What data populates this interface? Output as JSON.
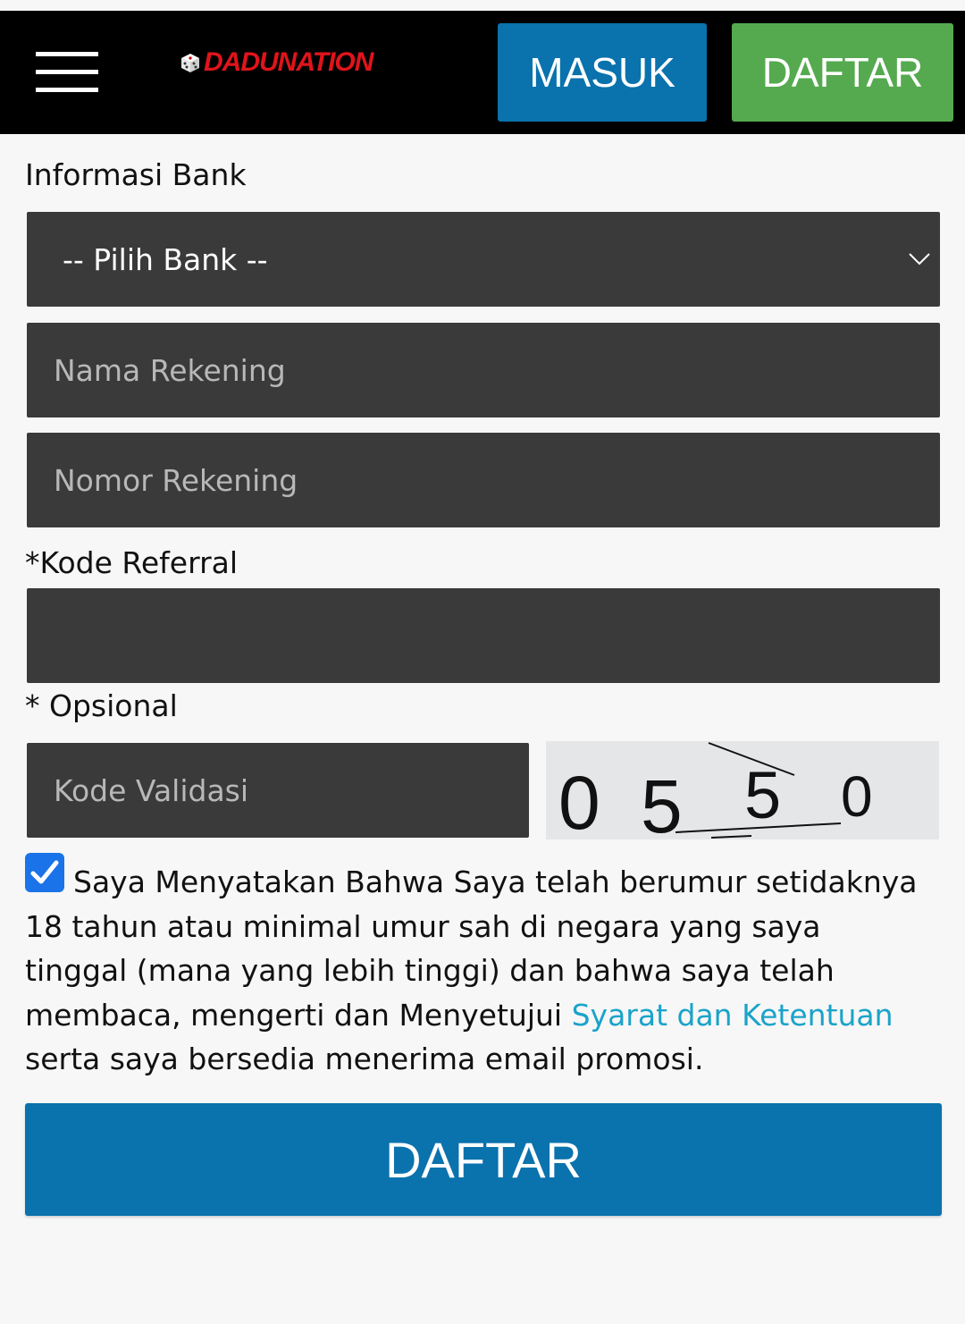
{
  "header": {
    "logo_text": "DADUNATION",
    "login_label": "MASUK",
    "register_label": "DAFTAR"
  },
  "bank_section": {
    "heading": "Informasi Bank",
    "bank_select_value": "-- Pilih Bank --",
    "account_name_placeholder": "Nama Rekening",
    "account_number_placeholder": "Nomor Rekening"
  },
  "referral": {
    "label": "*Kode Referral",
    "value": "",
    "optional_note": "* Opsional"
  },
  "validation": {
    "input_placeholder": "Kode Validasi",
    "captcha_digits": [
      "0",
      "5",
      "5",
      "0"
    ]
  },
  "terms": {
    "checked": true,
    "text_before": "Saya Menyatakan Bahwa Saya telah berumur setidaknya 18 tahun atau minimal umur sah di negara yang saya tinggal (mana yang lebih tinggi) dan bahwa saya telah membaca, mengerti dan Menyetujui ",
    "link_text": "Syarat dan Ketentuan",
    "text_after": " serta saya bersedia menerima email promosi."
  },
  "submit_label": "DAFTAR",
  "colors": {
    "header_bg": "#000000",
    "login_button": "#0a72ad",
    "register_button": "#55aa4f",
    "field_bg": "#3a3a3a",
    "link": "#1aa3c9",
    "checkbox": "#1a73e8",
    "logo": "#e0141b"
  }
}
